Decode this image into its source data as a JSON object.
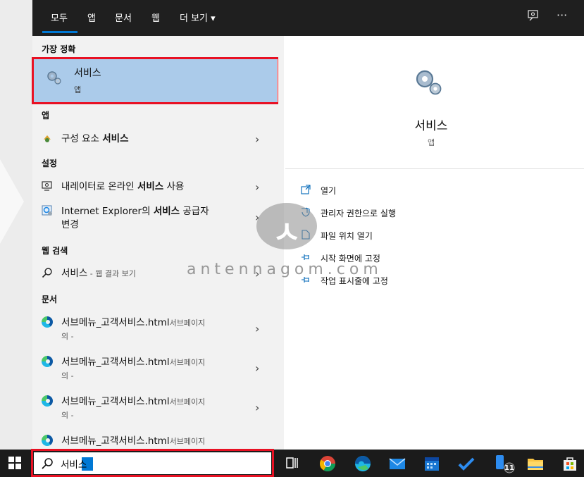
{
  "topbar": {
    "tabs": [
      {
        "label": "모두",
        "active": true
      },
      {
        "label": "앱"
      },
      {
        "label": "문서"
      },
      {
        "label": "웹"
      },
      {
        "label": "더 보기 ▾"
      }
    ],
    "icons": [
      "feedback-icon",
      "more-options-icon"
    ],
    "more_glyph": "···"
  },
  "results": {
    "best_match_header": "가장 정확",
    "best_match": {
      "title": "서비스",
      "subtitle": "앱",
      "icon": "services-gear-icon"
    },
    "apps_header": "앱",
    "apps": [
      {
        "label_prefix": "구성 요소 ",
        "label_bold": "서비스",
        "icon": "component-services-icon"
      }
    ],
    "settings_header": "설정",
    "settings": [
      {
        "label_prefix": "내레이터로 온라인 ",
        "label_bold": "서비스",
        "label_suffix": " 사용",
        "icon": "narrator-icon"
      },
      {
        "label_prefix": "Internet Explorer의 ",
        "label_bold": "서비스",
        "label_suffix": " 공급자",
        "label_line2": "변경",
        "icon": "ie-settings-icon"
      }
    ],
    "web_header": "웹 검색",
    "web": {
      "label": "서비스",
      "sub": " - 웹 결과 보기",
      "icon": "search-icon"
    },
    "docs_header": "문서",
    "docs": [
      {
        "title": "서브메뉴_고객서비스.html",
        "location": "서브페이지",
        "line2": "의 -"
      },
      {
        "title": "서브메뉴_고객서비스.html",
        "location": "서브페이지",
        "line2": "의 -"
      },
      {
        "title": "서브메뉴_고객서비스.html",
        "location": "서브페이지",
        "line2": "의 -"
      },
      {
        "title": "서브메뉴_고객서비스.html",
        "location": "서브페이지",
        "line2": ""
      }
    ]
  },
  "detail": {
    "title": "서비스",
    "subtitle": "앱",
    "actions": [
      {
        "label": "열기",
        "icon": "open-icon"
      },
      {
        "label": "관리자 권한으로 실행",
        "icon": "shield-icon"
      },
      {
        "label": "파일 위치 열기",
        "icon": "file-location-icon"
      },
      {
        "label": "시작 화면에 고정",
        "icon": "pin-icon"
      },
      {
        "label": "작업 표시줄에 고정",
        "icon": "pin-taskbar-icon"
      }
    ]
  },
  "watermark": {
    "glyph": "ㅅ",
    "text": "antennagom.com"
  },
  "taskbar": {
    "search_value": "서비스",
    "badge": "11"
  },
  "colors": {
    "accent": "#0078d4",
    "selection": "#abcbea",
    "highlight_box": "#e81123",
    "topbar": "#1f1f1f"
  }
}
